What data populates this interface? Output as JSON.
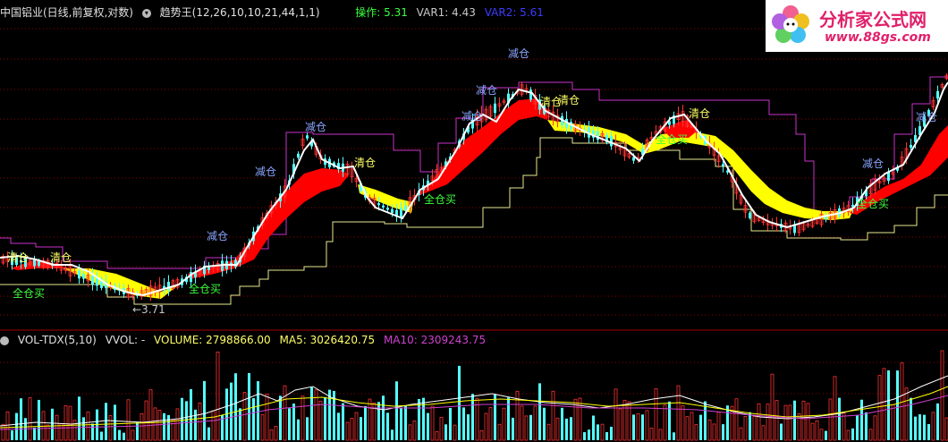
{
  "header": {
    "stock_title": "中国铝业(日线,前复权,对数)",
    "indicator_name": "趋势王(12,26,10,10,21,44,1,1)",
    "readouts": [
      {
        "label": "操作: 5.31",
        "color": "#3cff3c"
      },
      {
        "label": "VAR1: 4.43",
        "color": "#c8c8c8"
      },
      {
        "label": "VAR2: 5.61",
        "color": "#3c3cff"
      }
    ]
  },
  "logo": {
    "text": "分析家公式网",
    "url_text": "www.88gs.com",
    "color": "#e0206a"
  },
  "main_panel": {
    "low_marker": "←3.71",
    "signals": [
      {
        "text": "清仓",
        "color": "#ffff66"
      },
      {
        "text": "清仓",
        "color": "#ffff66"
      },
      {
        "text": "全仓买",
        "color": "#3cff3c"
      },
      {
        "text": "减仓",
        "color": "#8aa6ff"
      },
      {
        "text": "全仓买",
        "color": "#3cff3c"
      },
      {
        "text": "减仓",
        "color": "#8aa6ff"
      },
      {
        "text": "减仓",
        "color": "#8aa6ff"
      },
      {
        "text": "清仓",
        "color": "#ffff66"
      },
      {
        "text": "全仓买",
        "color": "#3cff3c"
      },
      {
        "text": "减仓",
        "color": "#8aa6ff"
      },
      {
        "text": "减仓",
        "color": "#8aa6ff"
      },
      {
        "text": "减仓",
        "color": "#8aa6ff"
      },
      {
        "text": "清仓",
        "color": "#ffff66"
      },
      {
        "text": "清仓",
        "color": "#ffff66"
      },
      {
        "text": "全仓买",
        "color": "#3cff3c"
      },
      {
        "text": "清仓",
        "color": "#ffff66"
      },
      {
        "text": "减仓",
        "color": "#8aa6ff"
      },
      {
        "text": "全仓买",
        "color": "#3cff3c"
      },
      {
        "text": "减仓",
        "color": "#8aa6ff"
      }
    ]
  },
  "volume_panel": {
    "title": "VOL-TDX(5,10)",
    "vvol": "VVOL: -",
    "volume": "VOLUME: 2798866.00",
    "ma5": "MA5: 3026420.75",
    "ma10": "MA10: 2309243.75"
  },
  "colors": {
    "up": "#ff3232",
    "down": "#54ffff",
    "ribbon_up": "#ff0000",
    "ribbon_down": "#ffff00",
    "stop_line": "#e8e890",
    "resistance": "#c832c8"
  }
}
